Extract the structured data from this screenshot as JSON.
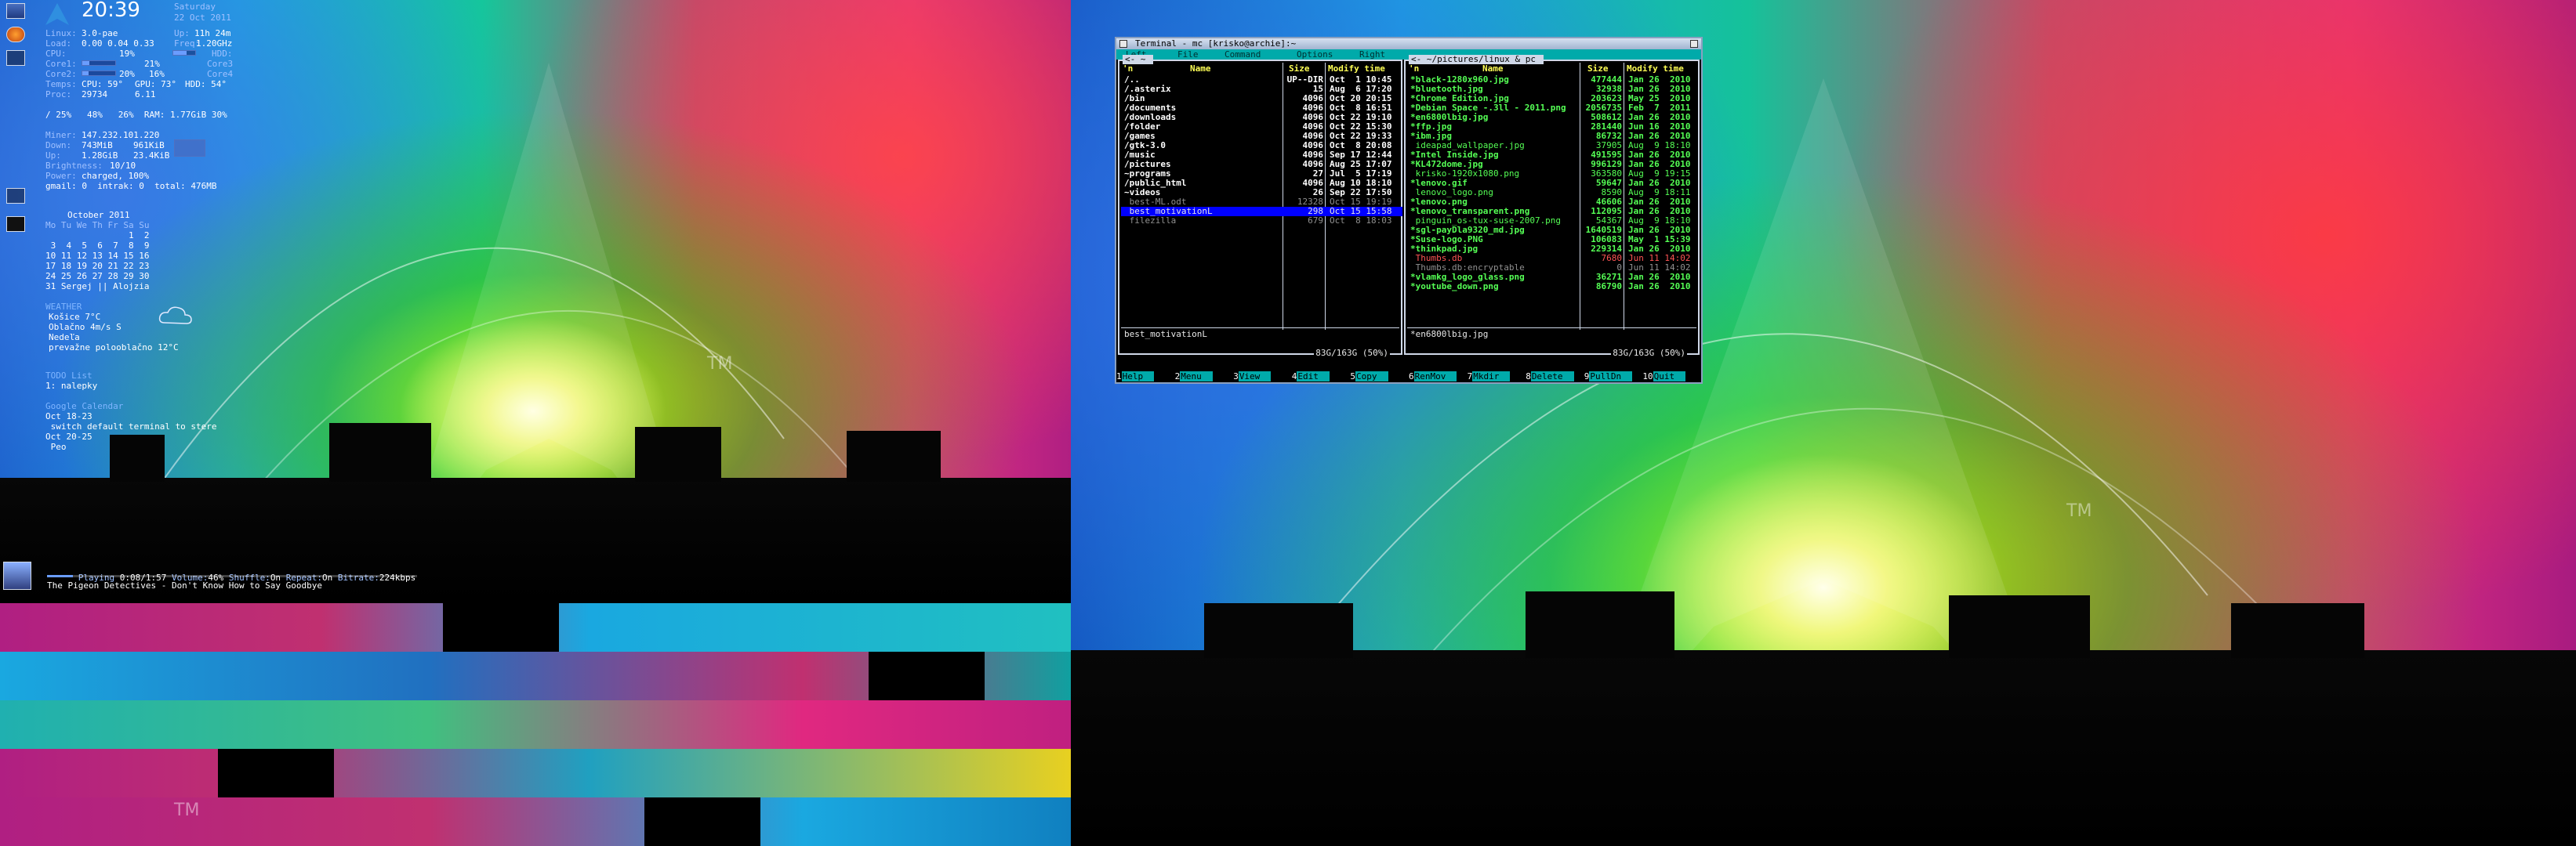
{
  "conky": {
    "clock": "20:39",
    "date_day": "Saturday",
    "date_full": "22 Oct 2011",
    "kernel_label": "Linux:",
    "kernel": "3.0-pae",
    "load_label": "Load:",
    "load": "0.00 0.04 0.33",
    "uptime_label": "Up:",
    "uptime": "11h 24m",
    "freq_label": "Freq:",
    "freq": "1.20GHz",
    "cpu_label": "CPU:",
    "cpu": "19%",
    "hdd_label": "HDD:",
    "core1_label": "Core1:",
    "core1": "21%",
    "core2_label": "Core2:",
    "core2": "20%",
    "core2b": "16%",
    "core3_label": "Core3",
    "core4_label": "Core4",
    "temp_label": "Temps:",
    "temp_cpu": "CPU: 59°",
    "temp_gpu": "GPU: 73°",
    "temp_hdd": "HDD: 54°",
    "proc_label": "Proc:",
    "proc": "29734",
    "proc2": "6.11",
    "fs_line": "/ 25%   48%   26%  RAM: 1.77GiB 30%",
    "ip_label": "Miner:",
    "ip": "147.232.101.220",
    "down_label": "Down:",
    "down": "743MiB",
    "down_rate": "961KiB",
    "up_label": "Up:",
    "up": "1.28GiB",
    "up_rate": "23.4KiB",
    "brightness_label": "Brightness:",
    "brightness": "10/10",
    "power_label": "Power:",
    "power": "charged, 100%",
    "gmail_line": "gmail: 0  intrak: 0  total: 476MB",
    "calendar": {
      "month": "October 2011",
      "header": "Mo Tu We Th Fr Sa Su",
      "weeks": [
        "                1  2",
        " 3  4  5  6  7  8  9",
        "10 11 12 13 14 15 16",
        "17 18 19 20 21 22 23",
        "24 25 26 27 28 29 30",
        "31 Sergej || Alojzia"
      ]
    },
    "weather_head": "WEATHER",
    "weather": [
      "Košice 7°C",
      "Oblačno 4m/s S",
      "Nedeľa",
      "prevažne polooblačno 12°C"
    ],
    "todo_head": "TODO List",
    "todo": [
      "1: nalepky"
    ],
    "gcal_head": "Google Calendar",
    "gcal": [
      "Oct 18-23",
      " switch default terminal to stere",
      "Oct 20-25",
      " Peo"
    ]
  },
  "mpd": {
    "playing_label": "Playing",
    "playing": "0:08/1:57",
    "volume_label": "Volume:",
    "volume": "46%",
    "shuffle_label": "Shuffle:",
    "shuffle": "On",
    "repeat_label": "Repeat:",
    "repeat": "On",
    "bitrate_label": "Bitrate:",
    "bitrate": "224kbps",
    "song": "The Pigeon Detectives - Don't Know How to Say Goodbye",
    "progress": 0.07
  },
  "wallpaper": {
    "tm_mark": "TM"
  },
  "terminal": {
    "title": "Terminal - mc [krisko@archie]:~",
    "menu": [
      "Left",
      "File",
      "Command",
      "Options",
      "Right"
    ],
    "left_panel": {
      "path": "<- ~ ",
      "headers": {
        "n": "'n",
        "name": "Name",
        "size": "Size",
        "mtime": "Modify time"
      },
      "rows": [
        {
          "n": "/..",
          "size": "UP--DIR",
          "mtime": "Oct  1 10:45",
          "type": "dir"
        },
        {
          "n": "/.asterix",
          "size": "15",
          "mtime": "Aug  6 17:20",
          "type": "dir"
        },
        {
          "n": "/bin",
          "size": "4096",
          "mtime": "Oct 20 20:15",
          "type": "dir"
        },
        {
          "n": "/documents",
          "size": "4096",
          "mtime": "Oct  8 16:51",
          "type": "dir"
        },
        {
          "n": "/downloads",
          "size": "4096",
          "mtime": "Oct 22 19:10",
          "type": "dir"
        },
        {
          "n": "/folder",
          "size": "4096",
          "mtime": "Oct 22 15:30",
          "type": "dir"
        },
        {
          "n": "/games",
          "size": "4096",
          "mtime": "Oct 22 19:33",
          "type": "dir"
        },
        {
          "n": "/gtk-3.0",
          "size": "4096",
          "mtime": "Oct  8 20:08",
          "type": "dir"
        },
        {
          "n": "/music",
          "size": "4096",
          "mtime": "Sep 17 12:44",
          "type": "dir"
        },
        {
          "n": "/pictures",
          "size": "4096",
          "mtime": "Aug 25 17:07",
          "type": "dir"
        },
        {
          "n": "~programs",
          "size": "27",
          "mtime": "Jul  5 17:19",
          "type": "dir"
        },
        {
          "n": "/public_html",
          "size": "4096",
          "mtime": "Aug 10 18:10",
          "type": "dir"
        },
        {
          "n": "~videos",
          "size": "26",
          "mtime": "Sep 22 17:50",
          "type": "dir"
        },
        {
          "n": " best-ML.odt",
          "size": "12328",
          "mtime": "Oct 15 19:19",
          "type": "dim"
        },
        {
          "n": " best_motivationL",
          "size": "298",
          "mtime": "Oct 15 15:58",
          "type": "sel"
        },
        {
          "n": " filezilla",
          "size": "679",
          "mtime": "Oct  8 18:03",
          "type": "dim"
        }
      ],
      "mini": "best_motivationL",
      "free": "83G/163G (50%)"
    },
    "right_panel": {
      "path": "<- ~/pictures/linux & pc ",
      "headers": {
        "n": "'n",
        "name": "Name",
        "size": "Size",
        "mtime": "Modify time"
      },
      "rows": [
        {
          "n": "*black-1280x960.jpg",
          "size": "477444",
          "mtime": "Jan 26  2010",
          "type": "exe"
        },
        {
          "n": "*bluetooth.jpg",
          "size": "32938",
          "mtime": "Jan 26  2010",
          "type": "exe"
        },
        {
          "n": "*Chrome Edition.jpg",
          "size": "203623",
          "mtime": "May 25  2010",
          "type": "exe"
        },
        {
          "n": "*Debian Space -.3ll - 2011.png",
          "size": "2056735",
          "mtime": "Feb  7  2011",
          "type": "exe"
        },
        {
          "n": "*en6800lbig.jpg",
          "size": "508612",
          "mtime": "Jan 26  2010",
          "type": "exe"
        },
        {
          "n": "*ffp.jpg",
          "size": "281440",
          "mtime": "Jun 16  2010",
          "type": "exe"
        },
        {
          "n": "*ibm.jpg",
          "size": "86732",
          "mtime": "Jan 26  2010",
          "type": "exe"
        },
        {
          "n": " ideapad_wallpaper.jpg",
          "size": "37905",
          "mtime": "Aug  9 18:10",
          "type": "img"
        },
        {
          "n": "*Intel Inside.jpg",
          "size": "491595",
          "mtime": "Jan 26  2010",
          "type": "exe"
        },
        {
          "n": "*KL472dome.jpg",
          "size": "996129",
          "mtime": "Jan 26  2010",
          "type": "exe"
        },
        {
          "n": " krisko-1920x1080.png",
          "size": "363580",
          "mtime": "Aug  9 19:15",
          "type": "img"
        },
        {
          "n": "*lenovo.gif",
          "size": "59647",
          "mtime": "Jan 26  2010",
          "type": "exe"
        },
        {
          "n": " lenovo_logo.png",
          "size": "8590",
          "mtime": "Aug  9 18:11",
          "type": "img"
        },
        {
          "n": "*lenovo.png",
          "size": "46606",
          "mtime": "Jan 26  2010",
          "type": "exe"
        },
        {
          "n": "*lenovo_transparent.png",
          "size": "112095",
          "mtime": "Jan 26  2010",
          "type": "exe"
        },
        {
          "n": " pinguin_os-tux-suse-2007.png",
          "size": "54367",
          "mtime": "Aug  9 18:10",
          "type": "img"
        },
        {
          "n": "*sgl-payDla9320_md.jpg",
          "size": "1640519",
          "mtime": "Jan 26  2010",
          "type": "exe"
        },
        {
          "n": "*Suse-logo.PNG",
          "size": "106083",
          "mtime": "May  1 15:39",
          "type": "exe"
        },
        {
          "n": "*thinkpad.jpg",
          "size": "229314",
          "mtime": "Jan 26  2010",
          "type": "exe"
        },
        {
          "n": " Thumbs.db",
          "size": "7680",
          "mtime": "Jun 11 14:02",
          "type": "red"
        },
        {
          "n": " Thumbs.db:encryptable",
          "size": "0",
          "mtime": "Jun 11 14:02",
          "type": "dim"
        },
        {
          "n": "*vlamkg_logo_glass.png",
          "size": "36271",
          "mtime": "Jan 26  2010",
          "type": "exe"
        },
        {
          "n": "*youtube_down.png",
          "size": "86790",
          "mtime": "Jan 26  2010",
          "type": "exe"
        }
      ],
      "mini": "*en6800lbig.jpg",
      "free": "83G/163G (50%)"
    },
    "fkeys": [
      {
        "num": "1",
        "label": "Help"
      },
      {
        "num": "2",
        "label": "Menu"
      },
      {
        "num": "3",
        "label": "View"
      },
      {
        "num": "4",
        "label": "Edit"
      },
      {
        "num": "5",
        "label": "Copy"
      },
      {
        "num": "6",
        "label": "RenMov"
      },
      {
        "num": "7",
        "label": "Mkdir"
      },
      {
        "num": "8",
        "label": "Delete"
      },
      {
        "num": "9",
        "label": "PullDn"
      },
      {
        "num": "10",
        "label": "Quit"
      }
    ]
  }
}
